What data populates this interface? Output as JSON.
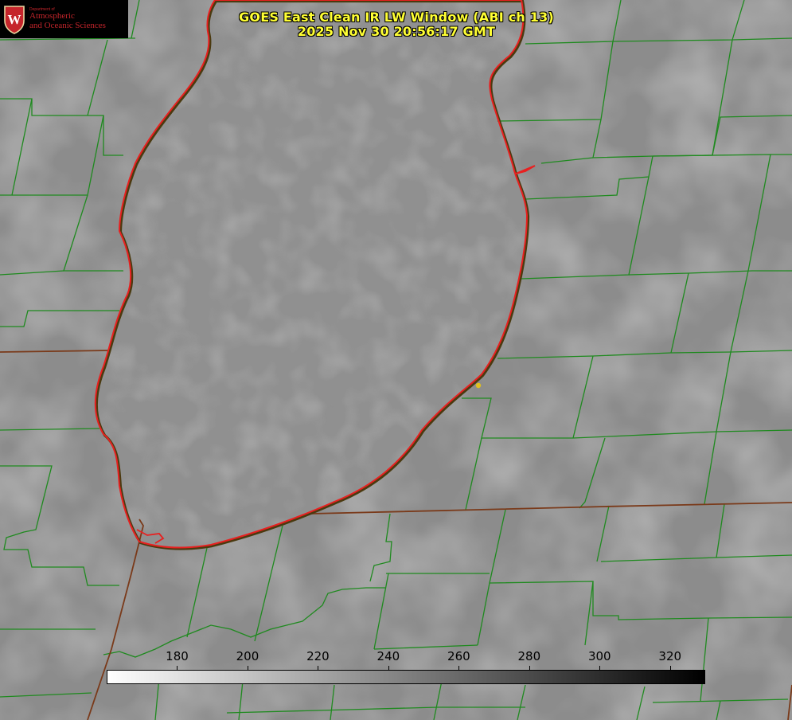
{
  "logo": {
    "department": "Department of",
    "line1": "Atmospheric",
    "line2": "and Oceanic Sciences",
    "crest_letter": "W",
    "crest_color": "#c5252b"
  },
  "title": {
    "line1": "GOES East Clean IR LW Window (ABI ch 13)",
    "line2": "2025 Nov 30 20:56:17 GMT"
  },
  "colors": {
    "title": "#ffff33",
    "county_borders": "#1f8a1f",
    "state_borders": "#7a3a1a",
    "shoreline": "#e82020",
    "marker": "#e0c020"
  },
  "colorbar": {
    "min": 160,
    "max": 330,
    "ticks": [
      "180",
      "200",
      "220",
      "240",
      "260",
      "280",
      "300",
      "320"
    ],
    "gradient": "white to black"
  },
  "marker": {
    "label": ""
  }
}
